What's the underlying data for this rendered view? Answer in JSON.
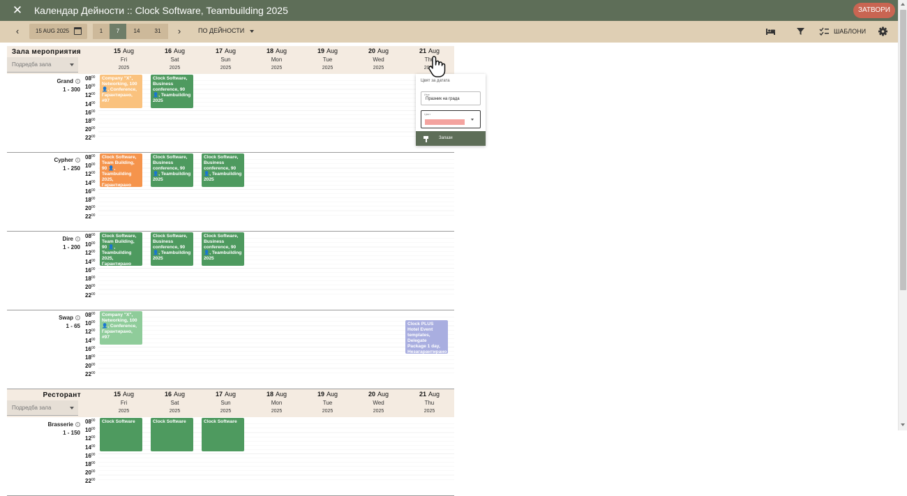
{
  "header": {
    "close_icon": "close-icon",
    "title": "Календар Дейности :: Clock Software, Teambuilding 2025",
    "close_button": "ЗАТВОРИ"
  },
  "toolbar": {
    "date": "15 AUG 2025",
    "ranges": [
      "1",
      "7",
      "14",
      "31"
    ],
    "active_range": "7",
    "activity_select": "ПО ДЕЙНОСТИ",
    "templates_label": "ШАБЛОНИ",
    "icons": [
      "chevron-left-icon",
      "calendar-icon",
      "chevron-right-icon",
      "bed-icon",
      "filter-icon",
      "checklist-icon",
      "gear-icon"
    ]
  },
  "days": [
    {
      "num": "15",
      "mon": "Aug",
      "dow": "Fri",
      "year": "2025"
    },
    {
      "num": "16",
      "mon": "Aug",
      "dow": "Sat",
      "year": "2025"
    },
    {
      "num": "17",
      "mon": "Aug",
      "dow": "Sun",
      "year": "2025"
    },
    {
      "num": "18",
      "mon": "Aug",
      "dow": "Mon",
      "year": "2025"
    },
    {
      "num": "19",
      "mon": "Aug",
      "dow": "Tue",
      "year": "2025"
    },
    {
      "num": "20",
      "mon": "Aug",
      "dow": "Wed",
      "year": "2025"
    },
    {
      "num": "21",
      "mon": "Aug",
      "dow": "Thu",
      "year": "2025"
    }
  ],
  "hour_labels": [
    "08",
    "10",
    "12",
    "14",
    "16",
    "18",
    "20",
    "22"
  ],
  "hour_suffix": "00",
  "sections": [
    {
      "title": "Зала мероприятия",
      "sort_placeholder": "Подредба зала",
      "rooms": [
        {
          "name": "Grand",
          "capacity": "1 - 300",
          "events": [
            {
              "day": 0,
              "color": "lightorange",
              "text": "Company \"X\", Networking, 100 👤, Conference, Гарантирано, #97"
            },
            {
              "day": 1,
              "color": "green",
              "text": "Clock Software, Business conference, 90 👤, Teambuilding 2025"
            }
          ]
        },
        {
          "name": "Cypher",
          "capacity": "1 - 250",
          "events": [
            {
              "day": 0,
              "color": "orange",
              "text": "Clock Software, Team Building, 90 👤, Teambuilding 2025, Гарантирано"
            },
            {
              "day": 1,
              "color": "green",
              "text": "Clock Software, Business conference, 90 👤, Teambuilding 2025"
            },
            {
              "day": 2,
              "color": "green",
              "text": "Clock Software, Business conference, 90 👤, Teambuilding 2025"
            }
          ]
        },
        {
          "name": "Dire",
          "capacity": "1 - 200",
          "events": [
            {
              "day": 0,
              "color": "green",
              "text": "Clock Software, Team Building, 90 👤, Teambuilding 2025, Гарантирано"
            },
            {
              "day": 1,
              "color": "green",
              "text": "Clock Software, Business conference, 90 👤, Teambuilding 2025"
            },
            {
              "day": 2,
              "color": "green",
              "text": "Clock Software, Business conference, 90 👤, Teambuilding 2025"
            }
          ]
        },
        {
          "name": "Swap",
          "capacity": "1 - 65",
          "events": [
            {
              "day": 0,
              "color": "lightgreen",
              "text": "Company \"X\", Networking, 100 👤, Conference, Гарантирано, #97"
            },
            {
              "day": 6,
              "color": "lavender",
              "text": "Clock PLUS Hotel Event templates, Delegate Package 1 day, Незагарантирано"
            }
          ]
        }
      ]
    },
    {
      "title": "Ресторант",
      "sort_placeholder": "Подредба зала",
      "rooms": [
        {
          "name": "Brasserie",
          "capacity": "1 - 150",
          "events": [
            {
              "day": 0,
              "color": "green",
              "text": "Clock Software"
            },
            {
              "day": 1,
              "color": "green",
              "text": "Clock Software"
            },
            {
              "day": 2,
              "color": "green",
              "text": "Clock Software"
            }
          ]
        }
      ]
    }
  ],
  "popup": {
    "title": "Цвят за датата",
    "name_label": "Име",
    "name_value": "Празник на града",
    "color_label": "Цвят",
    "color_value": "#f4a39f",
    "save_label": "Запази"
  },
  "colors": {
    "topbar": "#5e6e58",
    "toolbar": "#dfcfb4",
    "close_button": "#c96552",
    "event_green": "#4e9a5f",
    "event_orange": "#f5944c"
  }
}
